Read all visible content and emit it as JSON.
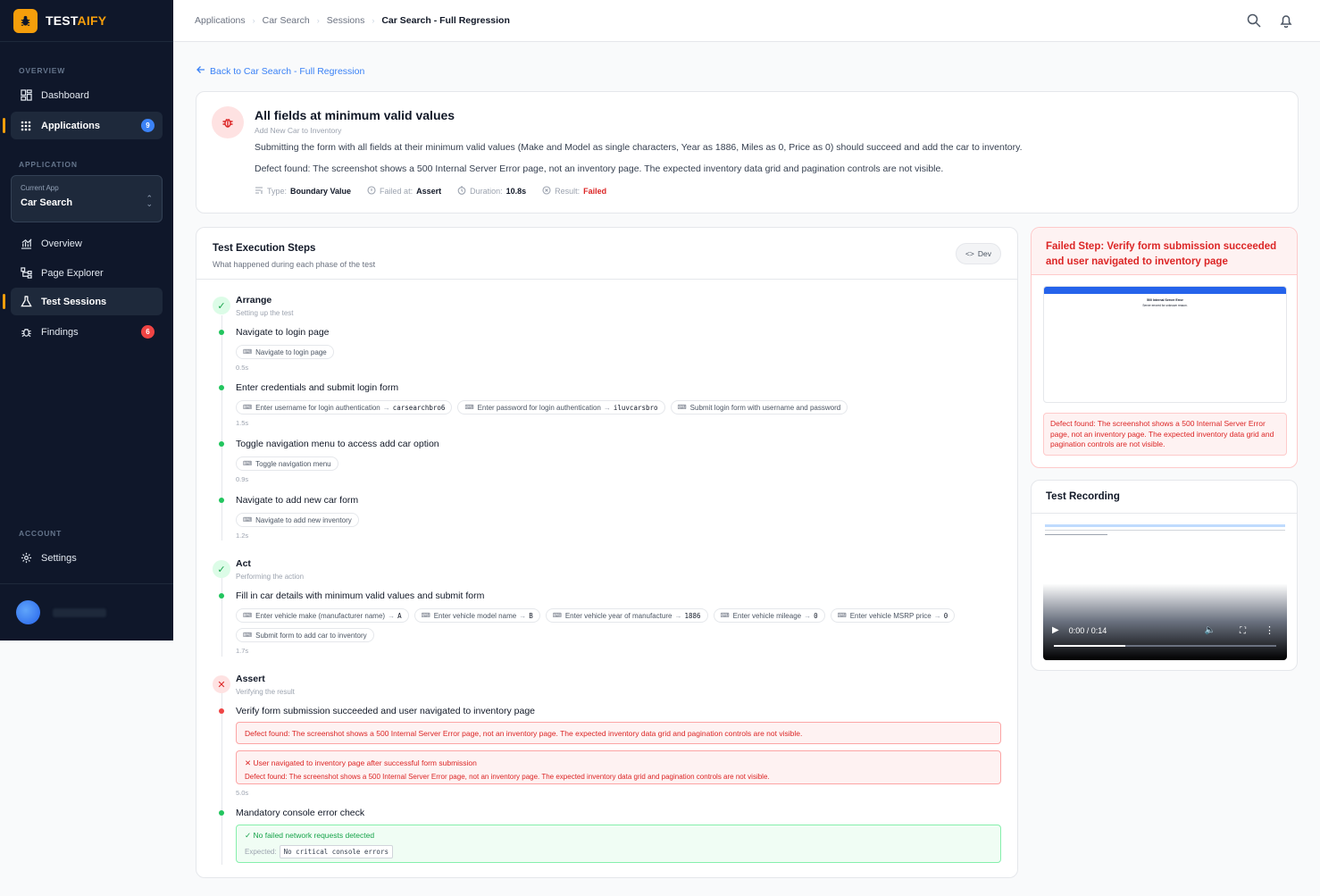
{
  "brand": {
    "name_main": "TEST",
    "name_accent": "AIFY"
  },
  "sidebar": {
    "overview_label": "OVERVIEW",
    "dashboard": "Dashboard",
    "applications": "Applications",
    "applications_badge": "9",
    "application_label": "APPLICATION",
    "current_app_label": "Current App",
    "current_app": "Car Search",
    "overview": "Overview",
    "page_explorer": "Page Explorer",
    "test_sessions": "Test Sessions",
    "findings": "Findings",
    "findings_badge": "6",
    "account_label": "ACCOUNT",
    "settings": "Settings"
  },
  "breadcrumbs": [
    "Applications",
    "Car Search",
    "Sessions",
    "Car Search - Full Regression"
  ],
  "back_link": "Back to Car Search - Full Regression",
  "test": {
    "title": "All fields at minimum valid values",
    "subtitle": "Add New Car to Inventory",
    "description": "Submitting the form with all fields at their minimum valid values (Make and Model as single characters, Year as 1886, Miles as 0, Price as 0) should succeed and add the car to inventory.",
    "defect": "Defect found: The screenshot shows a 500 Internal Server Error page, not an inventory page. The expected inventory data grid and pagination controls are not visible.",
    "type_label": "Type:",
    "type": "Boundary Value",
    "failed_at_label": "Failed at:",
    "failed_at": "Assert",
    "duration_label": "Duration:",
    "duration": "10.8s",
    "result_label": "Result:",
    "result": "Failed"
  },
  "steps_panel": {
    "title": "Test Execution Steps",
    "subtitle": "What happened during each phase of the test",
    "dev_button": "Dev",
    "arrange": {
      "name": "Arrange",
      "sub": "Setting up the test"
    },
    "act": {
      "name": "Act",
      "sub": "Performing the action"
    },
    "assert": {
      "name": "Assert",
      "sub": "Verifying the result"
    },
    "s1": {
      "name": "Navigate to login page",
      "chip1": "Navigate to login page",
      "dur": "0.5s"
    },
    "s2": {
      "name": "Enter credentials and submit login form",
      "chip1": "Enter username for login authentication",
      "chip1_val": "carsearchbro6",
      "chip2": "Enter password for login authentication",
      "chip2_val": "iluvcarsbro",
      "chip3": "Submit login form with username and password",
      "dur": "1.5s"
    },
    "s3": {
      "name": "Toggle navigation menu to access add car option",
      "chip1": "Toggle navigation menu",
      "dur": "0.9s"
    },
    "s4": {
      "name": "Navigate to add new car form",
      "chip1": "Navigate to add new inventory",
      "dur": "1.2s"
    },
    "s5": {
      "name": "Fill in car details with minimum valid values and submit form",
      "chip1": "Enter vehicle make (manufacturer name)",
      "chip1_val": "A",
      "chip2": "Enter vehicle model name",
      "chip2_val": "B",
      "chip3": "Enter vehicle year of manufacture",
      "chip3_val": "1886",
      "chip4": "Enter vehicle mileage",
      "chip4_val": "0",
      "chip5": "Enter vehicle MSRP price",
      "chip5_val": "0",
      "chip6": "Submit form to add car to inventory",
      "dur": "1.7s"
    },
    "s6": {
      "name": "Verify form submission succeeded and user navigated to inventory page",
      "error": "Defect found: The screenshot shows a 500 Internal Server Error page, not an inventory page. The expected inventory data grid and pagination controls are not visible.",
      "check_title": "User navigated to inventory page after successful form submission",
      "check_detail": "Defect found: The screenshot shows a 500 Internal Server Error page, not an inventory page. The expected inventory data grid and pagination controls are not visible.",
      "dur": "5.0s"
    },
    "s7": {
      "name": "Mandatory console error check",
      "check": "No failed network requests detected",
      "expected_label": "Expected:",
      "expected_val": "No critical console errors"
    }
  },
  "failed_step": {
    "title": "Failed Step: Verify form submission succeeded and user navigated to inventory page",
    "screenshot_title": "500 Internal Server Error",
    "screenshot_sub": "Server errored for unknown reason.",
    "defect": "Defect found: The screenshot shows a 500 Internal Server Error page, not an inventory page. The expected inventory data grid and pagination controls are not visible."
  },
  "recording": {
    "title": "Test Recording",
    "time": "0:00 / 0:14",
    "progress": 0.32
  },
  "colors": {
    "accent": "#f59e0b",
    "link": "#3b82f6",
    "success": "#22c55e",
    "danger": "#dc2626",
    "sidebar": "#0f172a"
  }
}
